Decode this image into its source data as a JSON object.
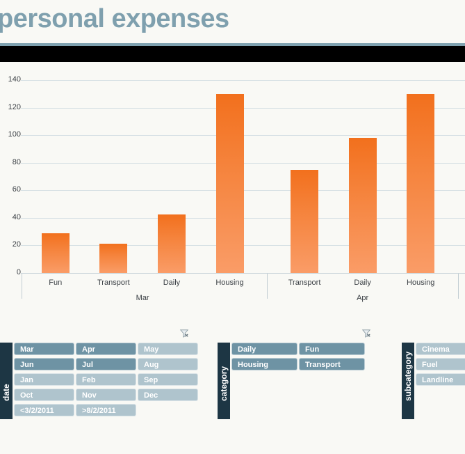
{
  "header": {
    "title": "personal expenses"
  },
  "chart_data": {
    "type": "bar",
    "title": "personal expenses",
    "xlabel": "",
    "ylabel": "",
    "ylim": [
      0,
      140
    ],
    "yticks": [
      0,
      20,
      40,
      60,
      80,
      100,
      120,
      140
    ],
    "grid": true,
    "legend": "none",
    "groups": [
      {
        "name": "Mar",
        "categories": [
          "Fun",
          "Transport",
          "Daily",
          "Housing"
        ],
        "values": [
          29,
          21,
          42.5,
          130
        ]
      },
      {
        "name": "Apr",
        "categories": [
          "Transport",
          "Daily",
          "Housing"
        ],
        "values": [
          75,
          98,
          130
        ]
      }
    ],
    "bar_color_top": "#F2701D",
    "bar_color_bottom": "#FA9C67"
  },
  "slicers": [
    {
      "id": "date",
      "label": "date",
      "clear_filter_icon": "clear-filter-icon",
      "columns": 3,
      "items": [
        {
          "label": "Mar",
          "selected": true
        },
        {
          "label": "Apr",
          "selected": true
        },
        {
          "label": "May",
          "selected": false
        },
        {
          "label": "Jun",
          "selected": true
        },
        {
          "label": "Jul",
          "selected": true
        },
        {
          "label": "Aug",
          "selected": false
        },
        {
          "label": "Jan",
          "selected": false
        },
        {
          "label": "Feb",
          "selected": false
        },
        {
          "label": "Sep",
          "selected": false
        },
        {
          "label": "Oct",
          "selected": false
        },
        {
          "label": "Nov",
          "selected": false
        },
        {
          "label": "Dec",
          "selected": false
        },
        {
          "label": "<3/2/2011",
          "selected": false
        },
        {
          "label": ">8/2/2011",
          "selected": false
        }
      ]
    },
    {
      "id": "category",
      "label": "category",
      "clear_filter_icon": "clear-filter-icon",
      "columns": 2,
      "items": [
        {
          "label": "Daily",
          "selected": true
        },
        {
          "label": "Fun",
          "selected": true
        },
        {
          "label": "Housing",
          "selected": true
        },
        {
          "label": "Transport",
          "selected": true
        }
      ]
    },
    {
      "id": "subcategory",
      "label": "subcategory",
      "clear_filter_icon": null,
      "columns": 1,
      "items": [
        {
          "label": "Cinema",
          "selected": false
        },
        {
          "label": "Fuel",
          "selected": false
        },
        {
          "label": "Landline",
          "selected": false
        }
      ]
    }
  ],
  "colors": {
    "title": "#7FA0AE",
    "spine": "#1D3644",
    "tile_on": "#6E93A4",
    "tile_off": "#AFC4CD",
    "background": "#F9F9F5",
    "gridline": "#D6E0E4"
  }
}
